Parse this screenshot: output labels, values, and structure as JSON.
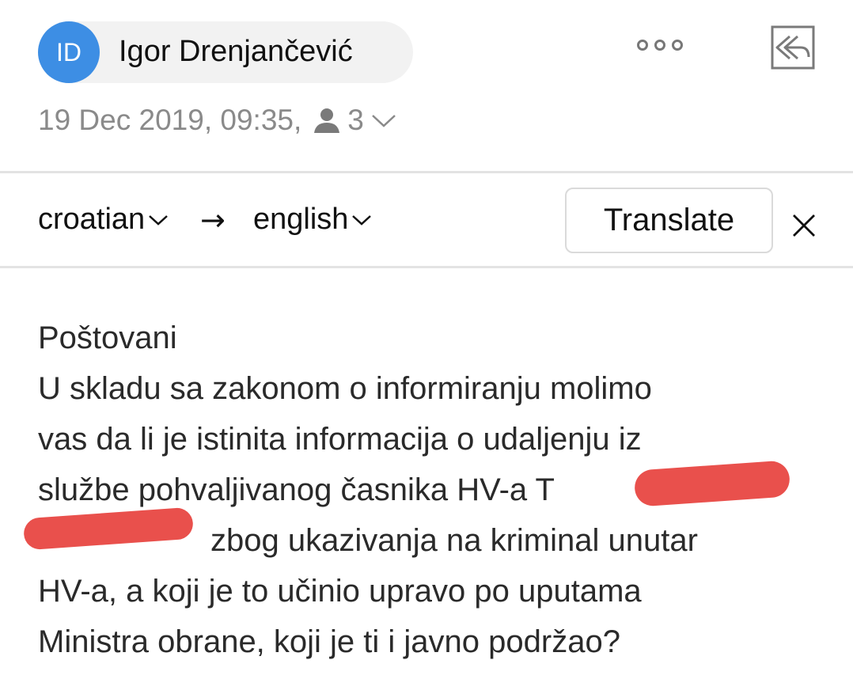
{
  "sender": {
    "initials": "ID",
    "name": "Igor Drenjančević"
  },
  "meta": {
    "datetime": "19 Dec 2019, 09:35,",
    "recipient_count": "3"
  },
  "translation_bar": {
    "source_language": "croatian",
    "arrow": "→",
    "target_language": "english",
    "translate_label": "Translate"
  },
  "message": {
    "lines": [
      "Poštovani",
      "U skladu sa zakonom o informiranju molimo",
      "vas da li je istinita informacija o udaljenju iz",
      "službe pohvaljivanog časnika HV-a T",
      " zbog ukazivanja na kriminal unutar",
      "HV-a, a koji je to učinio upravo po uputama",
      "Ministra obrane, koji je ti i javno podržao?"
    ]
  },
  "colors": {
    "avatar": "#3d8ee4",
    "redaction": "#e9504c",
    "meta_text": "#8a8a8a"
  },
  "icons": [
    "more-icon",
    "reply-all-icon",
    "person-icon",
    "chevron-down-icon",
    "close-icon"
  ]
}
